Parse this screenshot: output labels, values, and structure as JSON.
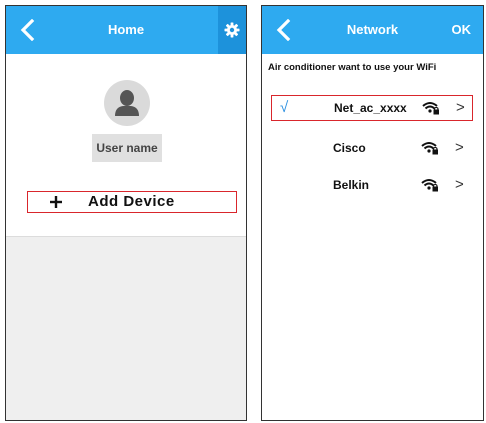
{
  "home": {
    "title": "Home",
    "username": "User name",
    "add_device_label": "Add Device"
  },
  "network": {
    "title": "Network",
    "ok_label": "OK",
    "prompt": "Air conditioner want to use your WiFi",
    "networks": [
      {
        "ssid": "Net_ac_xxxx",
        "selected": true,
        "check": "√"
      },
      {
        "ssid": "Cisco",
        "selected": false
      },
      {
        "ssid": "Belkin",
        "selected": false
      }
    ],
    "chevron": ">"
  },
  "colors": {
    "topbar": "#2eaaf0",
    "topbar_dark": "#1d92db",
    "highlight_border": "#d9262c",
    "check": "#2a8fe0"
  },
  "icons": {
    "back": "chevron-left-icon",
    "settings": "gear-icon",
    "avatar": "user-icon",
    "add": "plus-icon",
    "wifi": "wifi-lock-icon",
    "check": "checkmark-icon",
    "row_arrow": "chevron-right-icon"
  }
}
